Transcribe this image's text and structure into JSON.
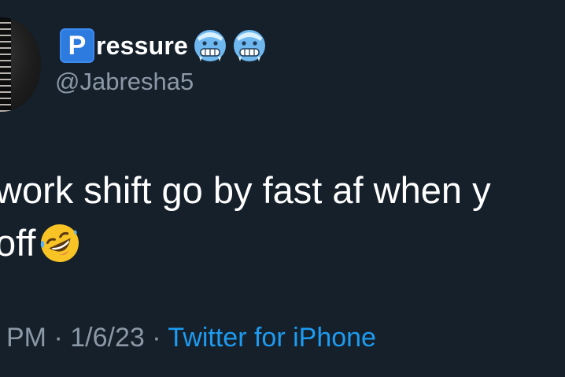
{
  "profile": {
    "badge_letter": "P",
    "display_name_rest": "ressure",
    "handle": "@Jabresha5",
    "name_emojis": [
      "cold-face-emoji",
      "cold-face-emoji"
    ]
  },
  "tweet": {
    "text_line1": "work shift go by fast af when y",
    "text_line2": "off",
    "trailing_emoji": "rofl-emoji"
  },
  "meta": {
    "time_fragment": "PM",
    "separator1": "·",
    "date": "1/6/23",
    "separator2": "·",
    "source": "Twitter for iPhone"
  },
  "colors": {
    "background": "#15202b",
    "primary_text": "#ffffff",
    "secondary_text": "#8b98a5",
    "link": "#1d9bf0",
    "badge": "#2e7be0"
  }
}
